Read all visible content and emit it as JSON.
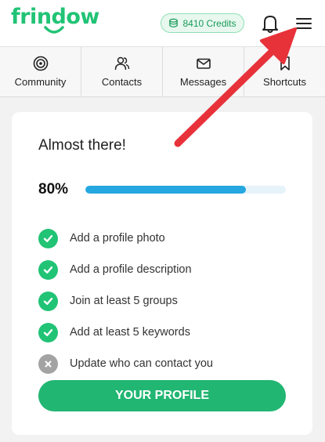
{
  "header": {
    "logo_text": "frindow",
    "credits_label": "8410 Credits",
    "brand_color": "#21c375"
  },
  "nav": {
    "items": [
      {
        "label": "Community",
        "icon": "target-icon"
      },
      {
        "label": "Contacts",
        "icon": "people-icon"
      },
      {
        "label": "Messages",
        "icon": "envelope-icon"
      },
      {
        "label": "Shortcuts",
        "icon": "bookmark-icon"
      }
    ]
  },
  "card": {
    "title": "Almost there!",
    "progress_label": "80%",
    "progress_value": 0.8,
    "checklist": [
      {
        "label": "Add a profile photo",
        "done": true
      },
      {
        "label": "Add a profile description",
        "done": true
      },
      {
        "label": "Join at least 5 groups",
        "done": true
      },
      {
        "label": "Add at least 5 keywords",
        "done": true
      },
      {
        "label": "Update who can contact you",
        "done": false
      }
    ],
    "button_label": "YOUR PROFILE"
  },
  "annotation": {
    "arrow_color": "#e8323a",
    "arrow_target": "menu-icon"
  }
}
